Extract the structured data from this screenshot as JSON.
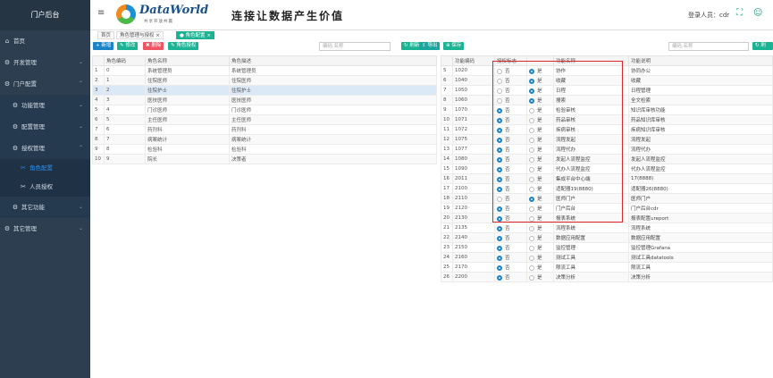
{
  "app": {
    "title": "门户后台"
  },
  "sidebar": {
    "items": [
      {
        "label": "首页",
        "icon": "home-icon",
        "glyph": "⌂",
        "level": 1
      },
      {
        "label": "开发管理",
        "icon": "gear-icon",
        "glyph": "⚙",
        "level": 1,
        "arrow": "⌄"
      },
      {
        "label": "门户配置",
        "icon": "gear-icon",
        "glyph": "⚙",
        "level": 1,
        "arrow": "⌃"
      },
      {
        "label": "功能管理",
        "icon": "gear-icon",
        "glyph": "⚙",
        "level": 2,
        "arrow": "⌄"
      },
      {
        "label": "配置管理",
        "icon": "gear-icon",
        "glyph": "⚙",
        "level": 2,
        "arrow": "⌄"
      },
      {
        "label": "授权管理",
        "icon": "gear-icon",
        "glyph": "⚙",
        "level": 2,
        "arrow": "⌃"
      },
      {
        "label": "角色配置",
        "icon": "wrench-icon",
        "glyph": "✂",
        "level": 3,
        "active": true
      },
      {
        "label": "人员授权",
        "icon": "wrench-icon",
        "glyph": "✂",
        "level": 3
      },
      {
        "label": "其它功能",
        "icon": "gear-icon",
        "glyph": "⚙",
        "level": 2,
        "arrow": "⌄"
      },
      {
        "label": "其它管理",
        "icon": "gear-icon",
        "glyph": "⚙",
        "level": 1,
        "arrow": "⌄"
      }
    ]
  },
  "header": {
    "brand": "DataWorld",
    "brand_sub": "共享开放共赢",
    "slogan": "连接让数据产生价值",
    "user": "登录人员：cdr",
    "menu_glyph": "≡",
    "fullscreen_glyph": "⛶",
    "user_glyph": "☺"
  },
  "tabs": [
    {
      "label": "首页",
      "active": false
    },
    {
      "label": "角色管理与授权",
      "active": false,
      "close": "×"
    },
    {
      "label": "● 角色配置",
      "active": true,
      "close": "×"
    }
  ],
  "left_toolbar": {
    "add": "+ 新增",
    "edit": "✎ 修改",
    "delete": "✖ 删除",
    "role_auth": "✎ 角色授权",
    "search_placeholder": "编码,名称",
    "refresh": "↻ 刷新",
    "export": "⇪ 导出"
  },
  "right_toolbar": {
    "save": "⊕ 保存",
    "search_placeholder": "编码,名称",
    "refresh": "↻ 刷新"
  },
  "role_table": {
    "headers": [
      "",
      "角色编码",
      "角色名称",
      "角色描述"
    ],
    "rows": [
      [
        "1",
        "0",
        "系统管理员",
        "系统管理员"
      ],
      [
        "2",
        "1",
        "住院医师",
        "住院医师"
      ],
      [
        "3",
        "2",
        "住院护士",
        "住院护士"
      ],
      [
        "4",
        "3",
        "医技医师",
        "医技医师"
      ],
      [
        "5",
        "4",
        "门诊医师",
        "门诊医师"
      ],
      [
        "6",
        "5",
        "主任医师",
        "主任医师"
      ],
      [
        "7",
        "6",
        "药剂科",
        "药剂科"
      ],
      [
        "8",
        "7",
        "病案统计",
        "病案统计"
      ],
      [
        "9",
        "8",
        "检验科",
        "检验科"
      ],
      [
        "10",
        "9",
        "院长",
        "决策者"
      ]
    ],
    "selected_row": 2
  },
  "func_table": {
    "headers": [
      "",
      "功能编码",
      "授权标志",
      "",
      "功能名称",
      "功能说明"
    ],
    "radio_no": "否",
    "radio_yes": "是",
    "rows": [
      [
        "5",
        "1020",
        "yes",
        "协作",
        "协同办公"
      ],
      [
        "6",
        "1040",
        "yes",
        "收藏",
        "收藏"
      ],
      [
        "7",
        "1050",
        "yes",
        "日程",
        "日程管理"
      ],
      [
        "8",
        "1060",
        "yes",
        "搜索",
        "全文检索"
      ],
      [
        "9",
        "1070",
        "no",
        "检验审核",
        "知识库审核功能"
      ],
      [
        "10",
        "1071",
        "no",
        "药品审核",
        "药品知识库审核"
      ],
      [
        "11",
        "1072",
        "no",
        "疾病审核",
        "疾病知识库审核"
      ],
      [
        "12",
        "1075",
        "no",
        "流程发起",
        "流程发起"
      ],
      [
        "13",
        "1077",
        "no",
        "流程代办",
        "流程代办"
      ],
      [
        "14",
        "1080",
        "no",
        "发起人流程监控",
        "发起人流程监控"
      ],
      [
        "15",
        "1090",
        "no",
        "代办人流程监控",
        "代办人流程监控"
      ],
      [
        "16",
        "2011",
        "no",
        "集成平台中心端",
        "17(8888)"
      ],
      [
        "17",
        "2100",
        "no",
        "适配器19(8880)",
        "适配器26(8880)"
      ],
      [
        "18",
        "2110",
        "yes",
        "医师门户",
        "医师门户"
      ],
      [
        "19",
        "2120",
        "no",
        "门户后台",
        "门户后台cdr"
      ],
      [
        "20",
        "2130",
        "no",
        "报表系统",
        "报表配置ureport"
      ],
      [
        "21",
        "2135",
        "no",
        "流程系统",
        "流程系统"
      ],
      [
        "22",
        "2140",
        "no",
        "数据应用配置",
        "数据应用配置"
      ],
      [
        "23",
        "2150",
        "no",
        "监控管理",
        "监控管理Grafana"
      ],
      [
        "24",
        "2160",
        "no",
        "测试工具",
        "测试工具datatools"
      ],
      [
        "25",
        "2170",
        "no",
        "限流工具",
        "限流工具"
      ],
      [
        "26",
        "2200",
        "no",
        "决策分析",
        "决策分析"
      ]
    ]
  },
  "colors": {
    "sidebar": "#2c3e50",
    "accent": "#1ab394",
    "primary": "#1c84c6",
    "danger": "#ed5565",
    "highlight": "#e0242b"
  }
}
